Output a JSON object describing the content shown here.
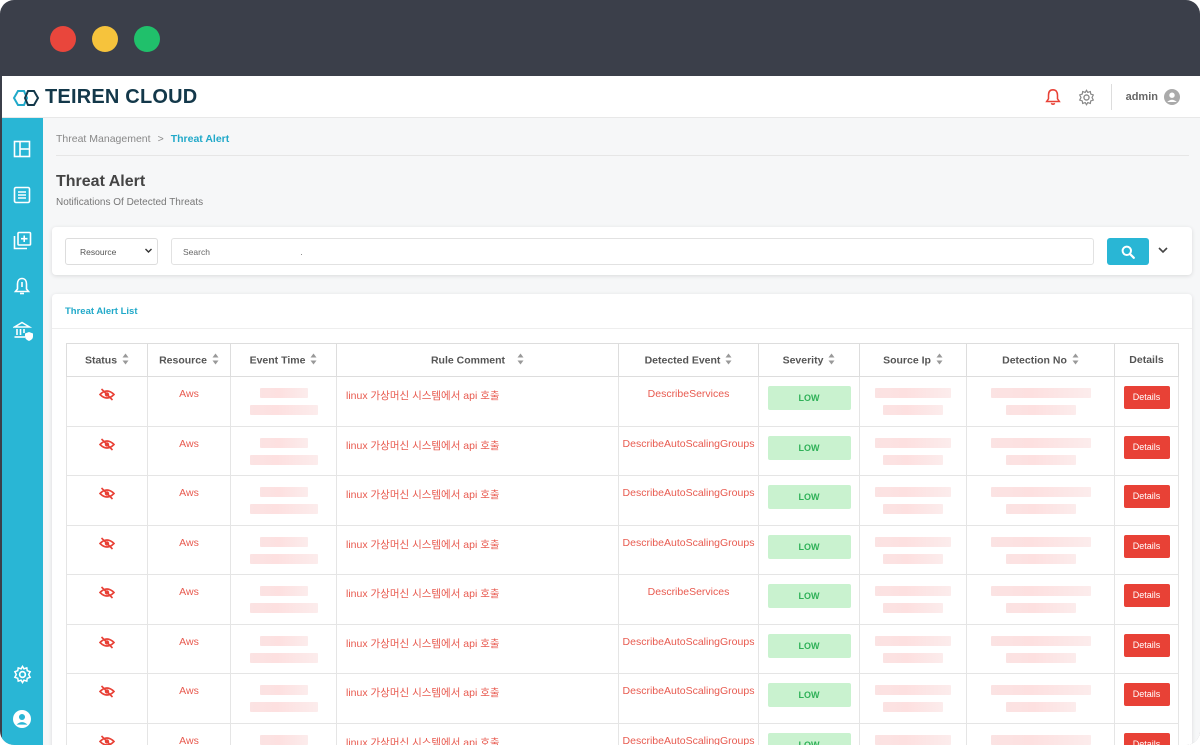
{
  "app": {
    "brand": "TEIREN CLOUD",
    "user": "admin"
  },
  "colors": {
    "accent": "#29b6d5",
    "danger": "#e84136",
    "ok_bg": "#c9f2cf",
    "ok_text": "#2fb158",
    "window_chrome": "#3b3f4a"
  },
  "window_controls": [
    "close",
    "minimize",
    "maximize"
  ],
  "header": {
    "icons": [
      "bell-icon",
      "gear-icon",
      "user-circle-icon"
    ]
  },
  "sidebar": {
    "top_icons": [
      "dashboard-icon",
      "list-icon",
      "add-copy-icon",
      "bell-alert-icon",
      "bank-shield-icon"
    ],
    "bottom_icons": [
      "settings-icon",
      "user-icon"
    ]
  },
  "breadcrumb": {
    "parent": "Threat Management",
    "separator": ">",
    "current": "Threat Alert"
  },
  "page": {
    "title": "Threat Alert",
    "subtitle": "Notifications Of Detected Threats"
  },
  "search": {
    "filter_selected": "Resource",
    "placeholder": "Search",
    "value": "."
  },
  "list": {
    "title": "Threat Alert List",
    "columns": [
      "Status",
      "Resource",
      "Event Time",
      "Rule Comment",
      "Detected Event",
      "Severity",
      "Source Ip",
      "Detection No",
      "Details"
    ],
    "rows": [
      {
        "resource": "Aws",
        "rule_comment": "linux 가상머신 시스템에서 api 호출",
        "detected_event": "DescribeServices",
        "severity": "LOW",
        "action": "Details"
      },
      {
        "resource": "Aws",
        "rule_comment": "linux 가상머신 시스템에서 api 호출",
        "detected_event": "DescribeAutoScalingGroups",
        "severity": "LOW",
        "action": "Details"
      },
      {
        "resource": "Aws",
        "rule_comment": "linux 가상머신 시스템에서 api 호출",
        "detected_event": "DescribeAutoScalingGroups",
        "severity": "LOW",
        "action": "Details"
      },
      {
        "resource": "Aws",
        "rule_comment": "linux 가상머신 시스템에서 api 호출",
        "detected_event": "DescribeAutoScalingGroups",
        "severity": "LOW",
        "action": "Details"
      },
      {
        "resource": "Aws",
        "rule_comment": "linux 가상머신 시스템에서 api 호출",
        "detected_event": "DescribeServices",
        "severity": "LOW",
        "action": "Details"
      },
      {
        "resource": "Aws",
        "rule_comment": "linux 가상머신 시스템에서 api 호출",
        "detected_event": "DescribeAutoScalingGroups",
        "severity": "LOW",
        "action": "Details"
      },
      {
        "resource": "Aws",
        "rule_comment": "linux 가상머신 시스템에서 api 호출",
        "detected_event": "DescribeAutoScalingGroups",
        "severity": "LOW",
        "action": "Details"
      },
      {
        "resource": "Aws",
        "rule_comment": "linux 가상머신 시스템에서 api 호출",
        "detected_event": "DescribeAutoScalingGroups",
        "severity": "LOW",
        "action": "Details"
      }
    ]
  }
}
